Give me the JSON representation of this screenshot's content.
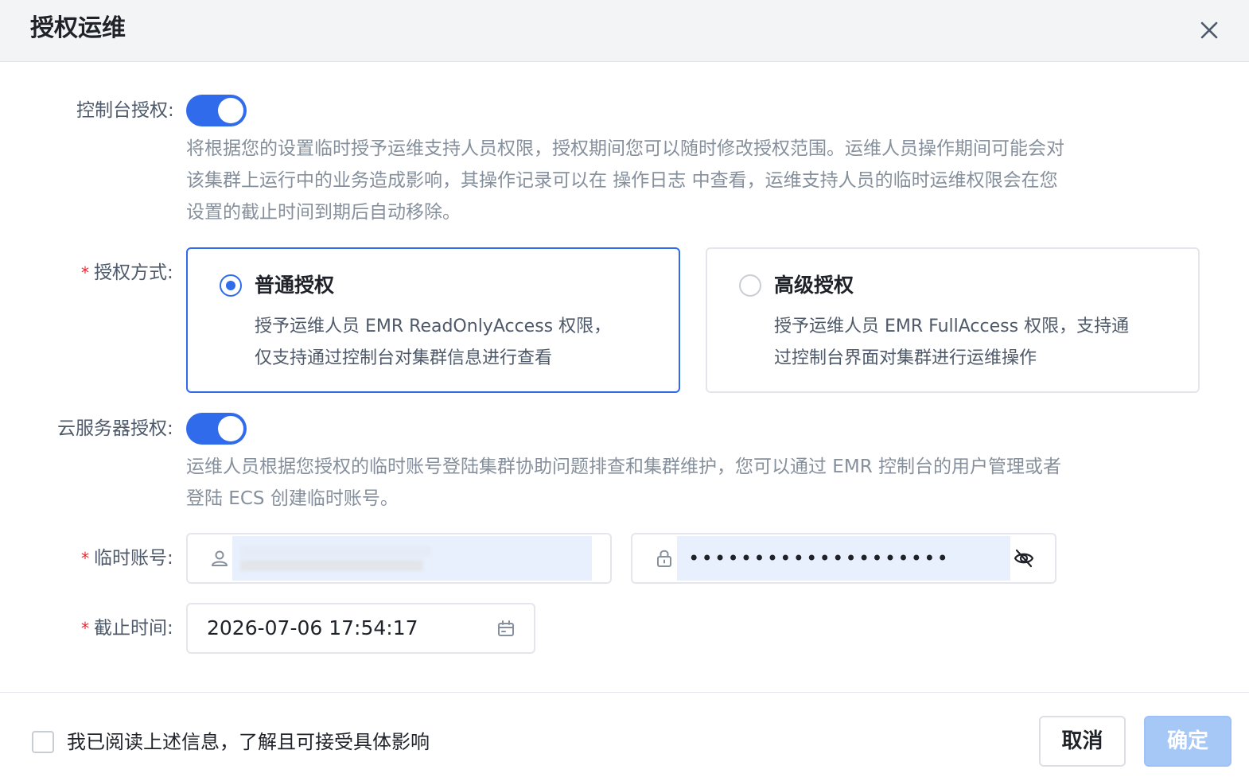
{
  "dialog": {
    "title": "授权运维"
  },
  "console_auth": {
    "label": "控制台授权:",
    "enabled": true,
    "desc_lines": [
      "将根据您的设置临时授予运维支持人员权限，授权期间您可以随时修改授权范围。运维人员操作期间可能会对",
      "该集群上运行中的业务造成影响，其操作记录可以在 操作日志 中查看，运维支持人员的临时运维权限会在您",
      "设置的截止时间到期后自动移除。"
    ]
  },
  "auth_mode": {
    "required_mark": "*",
    "label": "授权方式:",
    "options": [
      {
        "title": "普通授权",
        "desc_lines": [
          "授予运维人员 EMR ReadOnlyAccess 权限，",
          "仅支持通过控制台对集群信息进行查看"
        ],
        "selected": true
      },
      {
        "title": "高级授权",
        "desc_lines": [
          "授予运维人员 EMR FullAccess 权限，支持通",
          "过控制台界面对集群进行运维操作"
        ],
        "selected": false
      }
    ]
  },
  "server_auth": {
    "label": "云服务器授权:",
    "enabled": true,
    "desc_lines": [
      "运维人员根据您授权的临时账号登陆集群协助问题排查和集群维护，您可以通过 EMR 控制台的用户管理或者",
      "登陆 ECS 创建临时账号。"
    ]
  },
  "temp_account": {
    "required_mark": "*",
    "label": "临时账号:",
    "username_icon": "user-icon",
    "password_icon": "lock-icon",
    "password_value": "••••••••••••••••••••",
    "visibility_icon": "eye-off-icon"
  },
  "deadline": {
    "required_mark": "*",
    "label": "截止时间:",
    "value": "2026-07-06 17:54:17",
    "icon": "calendar-icon"
  },
  "footer": {
    "agree_label": "我已阅读上述信息，了解且可接受具体影响",
    "agree_checked": false,
    "cancel_label": "取消",
    "ok_label": "确定"
  },
  "colors": {
    "primary": "#2f6bea",
    "required": "#f5222d",
    "disabled_primary": "#a6c8f7"
  }
}
